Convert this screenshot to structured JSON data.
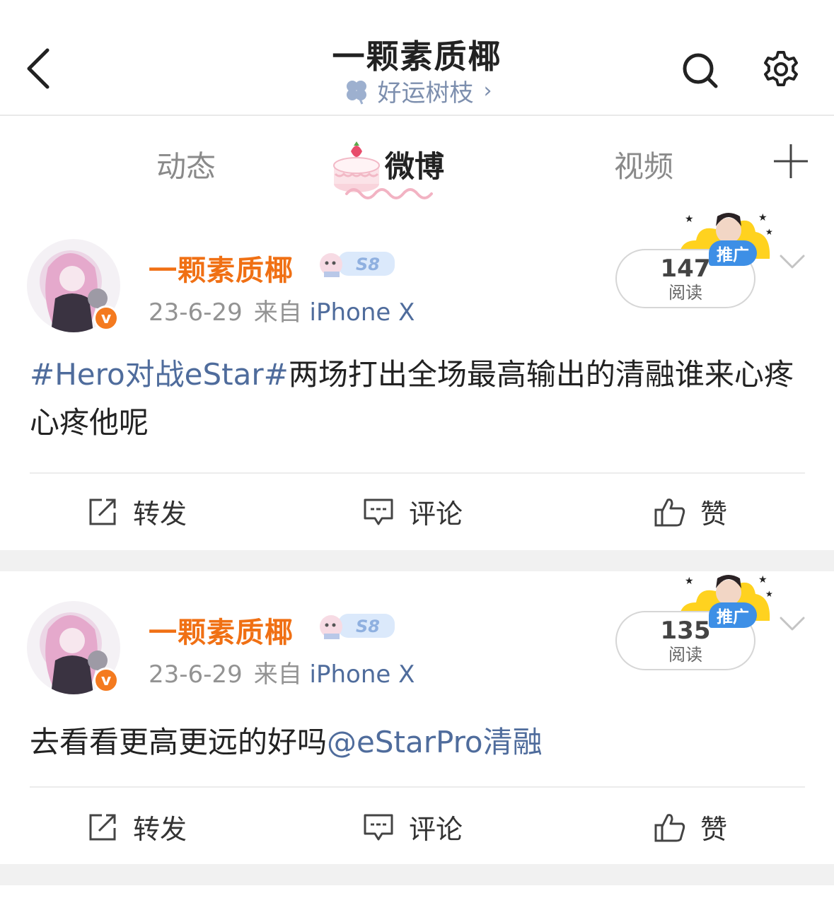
{
  "header": {
    "title": "一颗素质椰",
    "subtitle": "好运树枝",
    "subtitle_chevron": "›",
    "icons": [
      "back-icon",
      "search-icon",
      "settings-icon",
      "clover-icon"
    ]
  },
  "tabs": {
    "items": [
      {
        "label": "动态",
        "active": false
      },
      {
        "label": "微博",
        "active": true
      },
      {
        "label": "视频",
        "active": false
      }
    ],
    "add_icon": "plus-icon"
  },
  "posts": [
    {
      "author": "一颗素质椰",
      "level_badge": "S8",
      "verified_badge": "v",
      "date": "23-6-29",
      "from_label": "来自",
      "device": "iPhone X",
      "reads": "147",
      "reads_label": "阅读",
      "promo_tag": "推广",
      "text_link": "#Hero对战eStar#",
      "text_plain": "两场打出全场最高输出的清融谁来心疼心疼他呢",
      "actions": {
        "repost": "转发",
        "comment": "评论",
        "like": "赞"
      }
    },
    {
      "author": "一颗素质椰",
      "level_badge": "S8",
      "verified_badge": "v",
      "date": "23-6-29",
      "from_label": "来自",
      "device": "iPhone X",
      "reads": "135",
      "reads_label": "阅读",
      "promo_tag": "推广",
      "text_plain": "去看看更高更远的好吗",
      "text_link": "@eStarPro清融",
      "actions": {
        "repost": "转发",
        "comment": "评论",
        "like": "赞"
      }
    }
  ],
  "colors": {
    "accent_orange": "#f07014",
    "link_blue": "#4f6c9c",
    "promo_blue": "#3d8fe6",
    "verified_orange": "#f47a1f"
  }
}
